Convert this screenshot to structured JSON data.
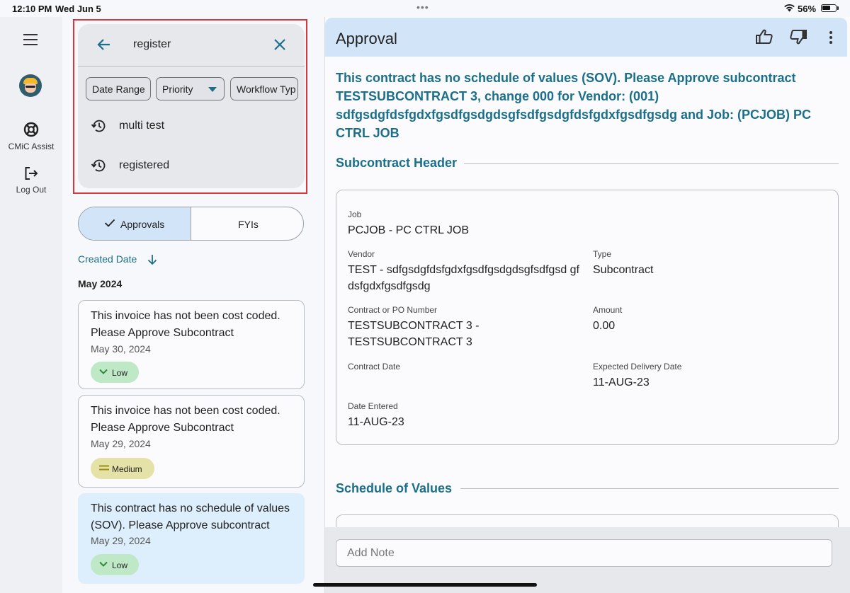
{
  "status_bar": {
    "time": "12:10 PM",
    "date": "Wed Jun 5",
    "battery": "56%"
  },
  "rail": {
    "items": [
      {
        "label": "CMiC Assist",
        "icon": "lifebuoy-icon"
      },
      {
        "label": "Log Out",
        "icon": "logout-icon"
      }
    ]
  },
  "search": {
    "query": "register",
    "filters": [
      "Date Range",
      "Priority",
      "Workflow Typ"
    ],
    "suggestions": [
      "multi test",
      "registered"
    ]
  },
  "tabs": {
    "approvals": "Approvals",
    "fyis": "FYIs"
  },
  "sort": {
    "label": "Created Date"
  },
  "list": {
    "month": "May 2024",
    "cards": [
      {
        "description": "This invoice has not been cost coded. Please Approve Subcontract",
        "date": "May 30, 2024",
        "priority": "Low"
      },
      {
        "description": "This invoice has not been cost coded. Please Approve Subcontract",
        "date": "May 29, 2024",
        "priority": "Medium"
      },
      {
        "description": "This contract has no schedule of values (SOV).  Please Approve subcontract",
        "date": "May 29, 2024",
        "priority": "Low"
      }
    ]
  },
  "detail": {
    "title": "Approval",
    "headline": "This contract has no schedule of values (SOV). Please Approve subcontract TESTSUBCONTRACT 3, change 000 for Vendor: (001) sdfgsdgfdsfgdxfgsdfgsdgdsgfsdfgsdgfdsfgdxfgsdfgsdg and Job: (PCJOB) PC CTRL JOB",
    "section_header": "Subcontract Header",
    "section_sov": "Schedule of Values",
    "fields": {
      "job_label": "Job",
      "job_value": "PCJOB - PC CTRL JOB",
      "vendor_label": "Vendor",
      "vendor_value": "TEST - sdfgsdgfdsfgdxfgsdfgsdgdsgfsdfgsd gfdsfgdxfgsdfgsdg",
      "type_label": "Type",
      "type_value": "Subcontract",
      "contract_label": "Contract or PO Number",
      "contract_value": "TESTSUBCONTRACT 3 - TESTSUBCONTRACT 3",
      "amount_label": "Amount",
      "amount_value": "0.00",
      "contract_date_label": "Contract Date",
      "contract_date_value": "",
      "delivery_label": "Expected Delivery Date",
      "delivery_value": "11-AUG-23",
      "entered_label": "Date Entered",
      "entered_value": "11-AUG-23"
    },
    "note_placeholder": "Add Note"
  },
  "colors": {
    "accent": "#1b6f8a",
    "selected": "#d2e4f7",
    "low": "#bfe8c6",
    "medium": "#e5e2a8",
    "highlight": "#d9363e"
  }
}
